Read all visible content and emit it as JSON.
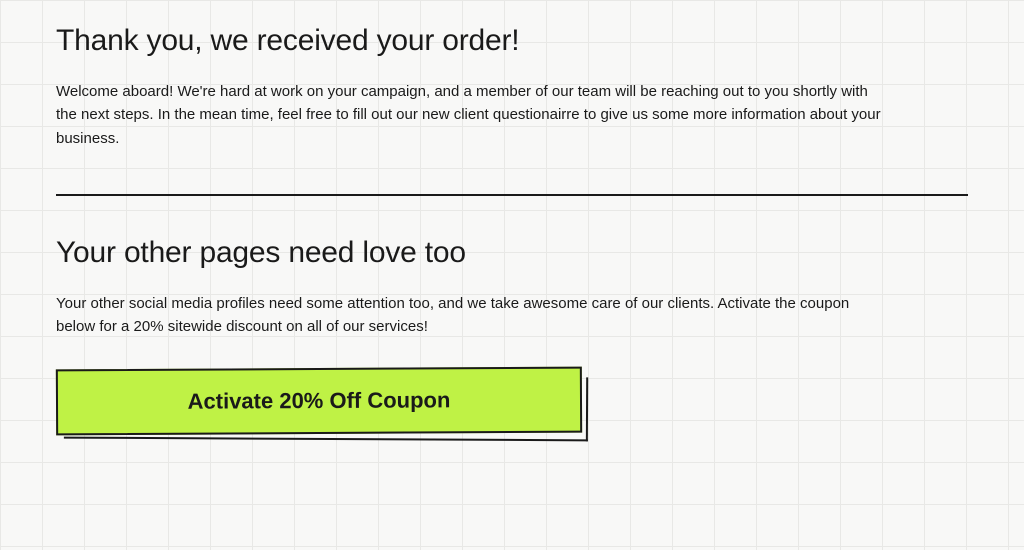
{
  "section1": {
    "heading": "Thank you, we received your order!",
    "body": "Welcome aboard! We're hard at work on your campaign, and a member of our team will be reaching out to you shortly with the next steps. In the mean time, feel free to fill out our new client questionairre to give us some more information about your business."
  },
  "section2": {
    "heading": "Your other pages need love too",
    "body": "Your other social media profiles need some attention too, and we take awesome care of our clients. Activate the coupon below for a 20% sitewide discount on all of our services!",
    "button_label": "Activate 20% Off Coupon"
  },
  "colors": {
    "accent": "#bff245",
    "text": "#1a1a1a",
    "grid": "#e8e8e6",
    "bg": "#f8f8f7"
  }
}
